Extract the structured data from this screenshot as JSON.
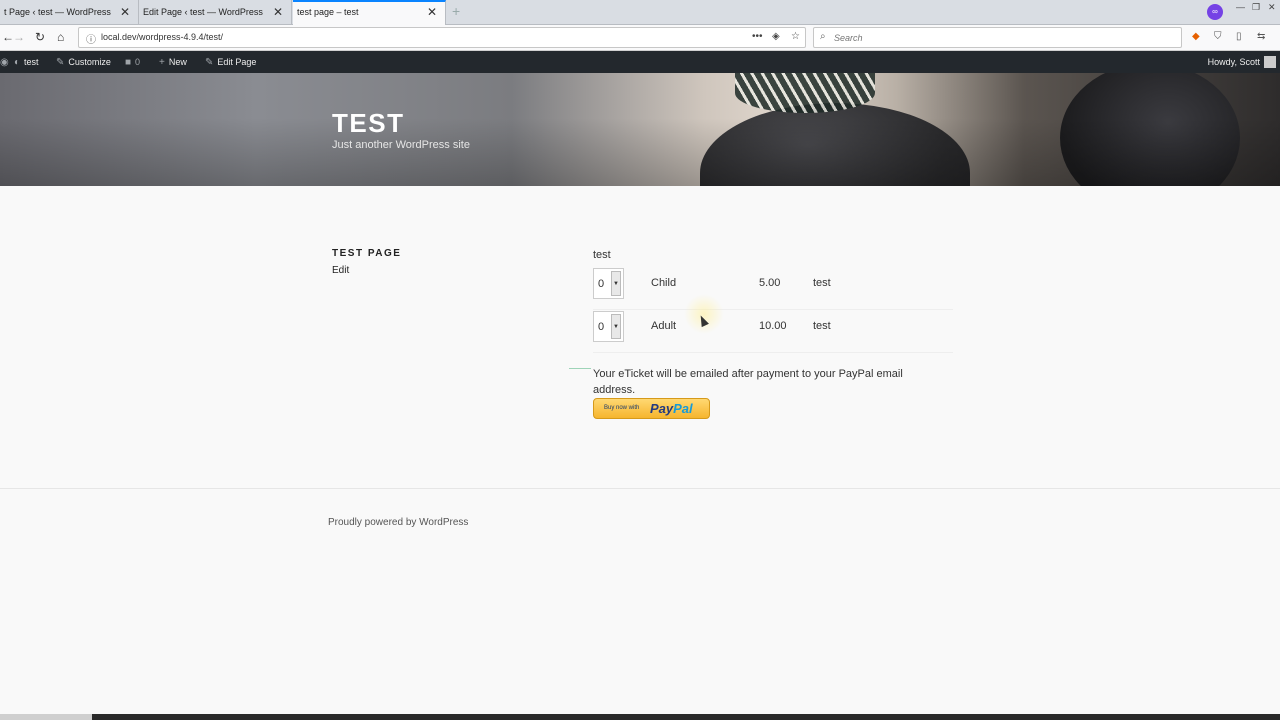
{
  "browser": {
    "tabs": [
      {
        "title": "t Page ‹ test — WordPress"
      },
      {
        "title": "Edit Page ‹ test — WordPress"
      },
      {
        "title": "test page – test"
      }
    ],
    "url": "local.dev/wordpress-4.9.4/test/",
    "search_placeholder": "Search"
  },
  "adminbar": {
    "site": "test",
    "customize": "Customize",
    "comments": "0",
    "new": "New",
    "edit_page": "Edit Page",
    "howdy": "Howdy, Scott"
  },
  "site": {
    "title": "TEST",
    "description": "Just another WordPress site"
  },
  "page": {
    "title": "TEST PAGE",
    "edit": "Edit"
  },
  "ticket_form": {
    "heading": "test",
    "rows": [
      {
        "qty": "0",
        "name": "Child",
        "price": "5.00",
        "desc": "test"
      },
      {
        "qty": "0",
        "name": "Adult",
        "price": "10.00",
        "desc": "test"
      }
    ],
    "note": "Your eTicket will be emailed after payment to your PayPal email address.",
    "paypal_small": "Buy now with",
    "paypal_pay": "Pay",
    "paypal_pal": "Pal"
  },
  "footer": {
    "text": "Proudly powered by WordPress"
  },
  "colors": {
    "adminbar_bg": "#23282d",
    "paypal_yellow": "#f6b52e",
    "paypal_blue": "#253b80",
    "tab_accent": "#0a84ff"
  }
}
